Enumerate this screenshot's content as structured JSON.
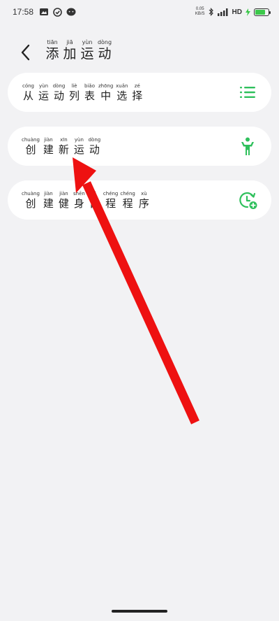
{
  "status": {
    "time": "17:58",
    "net_speed_value": "0.05",
    "net_speed_unit": "KB/S",
    "network": "HD",
    "battery_level": 0.8
  },
  "header": {
    "title": [
      {
        "py": "tiān",
        "hz": "添"
      },
      {
        "py": "jiā",
        "hz": "加"
      },
      {
        "py": "yùn",
        "hz": "运"
      },
      {
        "py": "dòng",
        "hz": "动"
      }
    ]
  },
  "options": [
    {
      "label": [
        {
          "py": "cóng",
          "hz": "从"
        },
        {
          "py": "yùn",
          "hz": "运"
        },
        {
          "py": "dòng",
          "hz": "动"
        },
        {
          "py": "liè",
          "hz": "列"
        },
        {
          "py": "biǎo",
          "hz": "表"
        },
        {
          "py": "zhōng",
          "hz": "中"
        },
        {
          "py": "xuǎn",
          "hz": "选"
        },
        {
          "py": "zé",
          "hz": "择"
        }
      ],
      "icon": "list-icon"
    },
    {
      "label": [
        {
          "py": "chuàng",
          "hz": "创"
        },
        {
          "py": "jiàn",
          "hz": "建"
        },
        {
          "py": "xīn",
          "hz": "新"
        },
        {
          "py": "yùn",
          "hz": "运"
        },
        {
          "py": "dòng",
          "hz": "动"
        }
      ],
      "icon": "fitness-person-icon"
    },
    {
      "label": [
        {
          "py": "chuàng",
          "hz": "创"
        },
        {
          "py": "jiàn",
          "hz": "建"
        },
        {
          "py": "jiàn",
          "hz": "健"
        },
        {
          "py": "shēn",
          "hz": "身"
        },
        {
          "py": "rì",
          "hz": "日"
        },
        {
          "py": "chéng",
          "hz": "程"
        },
        {
          "py": "chéng",
          "hz": "程"
        },
        {
          "py": "xù",
          "hz": "序"
        }
      ],
      "icon": "schedule-add-icon"
    }
  ],
  "colors": {
    "accent": "#2fc05c",
    "background": "#f2f2f4",
    "card": "#ffffff",
    "annotation_arrow": "#ee1111"
  }
}
